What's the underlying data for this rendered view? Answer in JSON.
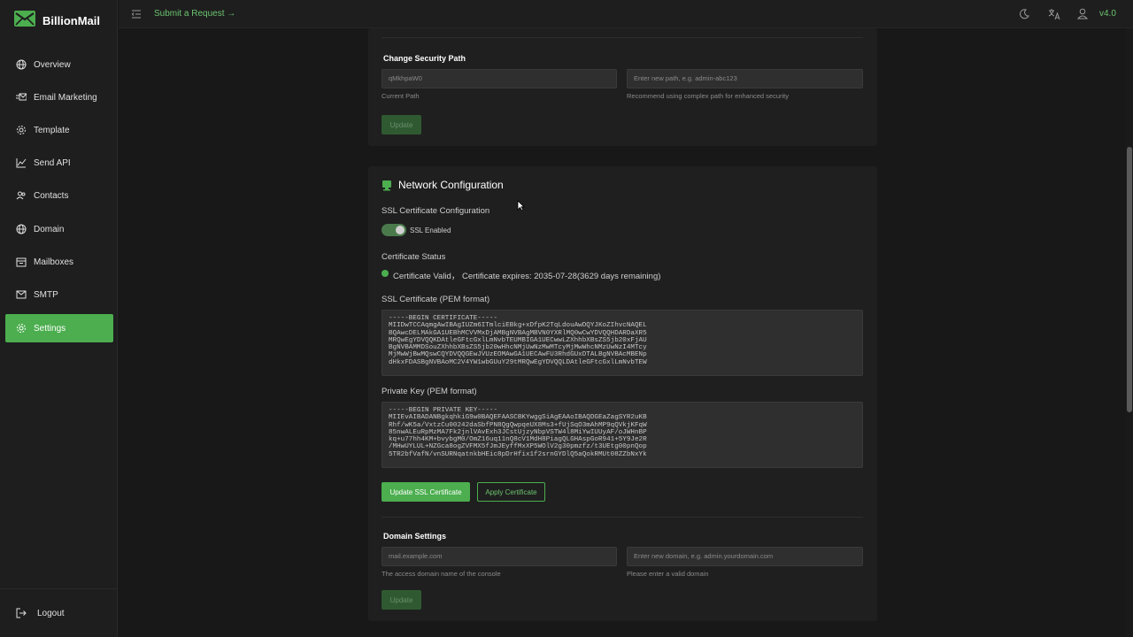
{
  "app": {
    "name": "BillionMail",
    "version": "v4.0"
  },
  "topbar": {
    "submit_request": "Submit a Request →"
  },
  "sidebar": {
    "items": [
      {
        "label": "Overview",
        "icon": "globe-icon"
      },
      {
        "label": "Email Marketing",
        "icon": "email-marketing-icon"
      },
      {
        "label": "Template",
        "icon": "gear-icon"
      },
      {
        "label": "Send API",
        "icon": "chart-line-icon"
      },
      {
        "label": "Contacts",
        "icon": "contacts-icon"
      },
      {
        "label": "Domain",
        "icon": "globe-icon"
      },
      {
        "label": "Mailboxes",
        "icon": "mailbox-icon"
      },
      {
        "label": "SMTP",
        "icon": "mail-icon"
      },
      {
        "label": "Settings",
        "icon": "gear-icon",
        "active": true
      }
    ],
    "logout": "Logout"
  },
  "security_path": {
    "title": "Change Security Path",
    "current_value": "qMkhpaW0",
    "new_placeholder": "Enter new path, e.g. admin-abc123",
    "current_hint": "Current Path",
    "new_hint": "Recommend using complex path for enhanced security",
    "update_label": "Update"
  },
  "network": {
    "title": "Network Configuration",
    "ssl_config_label": "SSL Certificate Configuration",
    "ssl_toggle_label": "SSL Enabled",
    "ssl_enabled": true,
    "cert_status_label": "Certificate Status",
    "cert_status_text": "Certificate Valid， Certificate expires: 2035-07-28(3629 days remaining)",
    "cert_label": "SSL Certificate (PEM format)",
    "cert_text": "-----BEGIN CERTIFICATE-----\nMIIDwTCCAqmgAwIBAgIUZm6ITmlciEBkg+xDfpK2TqLdouAwDQYJKoZIhvcNAQEL\nBQAwcDELMAkGA1UEBhMCVVMxDjAMBgNVBAgMBVN0YXRlMQ0wCwYDVQQHDARDaXR5\nMRQwEgYDVQQKDAtleGFtcGxlLmNvbTEUMBIGA1UECwwLZXhhbXBsZS5jb20xFjAU\nBgNVBAMMDSouZXhhbXBsZS5jb20wHhcNMjUwNzMwMTcyMjMwWhcNMzUwNzI4MTcy\nMjMwWjBwMQswCQYDVQQGEwJVUzEOMAwGA1UECAwFU3RhdGUxDTALBgNVBAcMBENp\ndHkxFDASBgNVBAoMC2V4YW1wbGUuY29tMRQwEgYDVQQLDAtleGFtcGxlLmNvbTEW",
    "key_label": "Private Key (PEM format)",
    "key_text": "-----BEGIN PRIVATE KEY-----\nMIIEvAIBADANBgkqhkiG9w0BAQEFAASCBKYwggSiAgEAAoIBAQDGEaZagSYR2uKB\nRhf/wK5a/VxtzCu00242daSbfPN8QgQwpqeUX8Ms3+fUjSqO3mAhMP9qQVkjKFqW\n85nwALEuRpMzMA7Fk2jnlVAvExh3JCstUjzyNbpVSTW4l8MiYwIUUyAF/oJWHnBP\nkq+u77hh4KM+bvybgM0/OmZ16uq11nQ8cV1MdH8PiagQLGHAspGoR941+5Y9Je2R\n/MHwUYLUL+NZGca8ogZVFMX5fJmJEyffMxXP5WOlV2g30pmzfz/t3UEtg00pnQop\n5TR2bfVafN/vnSURNqatnkbHEic8pDrHfix1f2srnGYDlQ5aQokRMUt08ZZbNxYk",
    "update_ssl_label": "Update SSL Certificate",
    "apply_cert_label": "Apply Certificate"
  },
  "domain_settings": {
    "title": "Domain Settings",
    "current_value": "mail.example.com",
    "new_placeholder": "Enter new domain, e.g. admin.yourdomain.com",
    "current_hint": "The access domain name of the console",
    "new_hint": "Please enter a valid domain",
    "update_label": "Update"
  },
  "colors": {
    "accent": "#4cae4f",
    "background": "#181818",
    "card": "#1f1f1f",
    "sidebar": "#1e1e1e"
  }
}
